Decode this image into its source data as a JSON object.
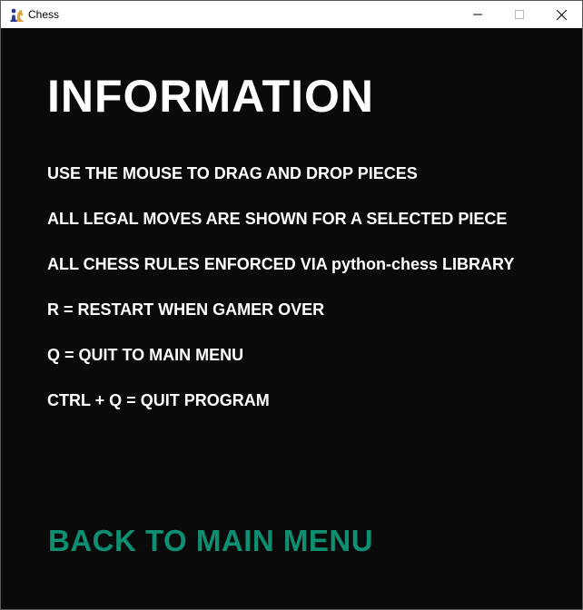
{
  "window": {
    "title": "Chess",
    "app_icon": "chess-pieces-icon",
    "controls": {
      "minimize_icon": "minimize-icon",
      "maximize_icon": "maximize-icon",
      "close_icon": "close-icon"
    }
  },
  "page": {
    "heading": "INFORMATION",
    "lines": [
      "USE THE MOUSE TO DRAG AND DROP PIECES",
      "ALL LEGAL MOVES ARE SHOWN FOR A SELECTED PIECE",
      "ALL CHESS RULES ENFORCED VIA python-chess LIBRARY",
      "R = RESTART WHEN GAMER OVER",
      "Q = QUIT TO MAIN MENU",
      "CTRL + Q = QUIT PROGRAM"
    ],
    "back_button_label": "BACK TO MAIN MENU"
  },
  "colors": {
    "background": "#0a0a0a",
    "text": "#ffffff",
    "accent": "#0f8f72"
  }
}
